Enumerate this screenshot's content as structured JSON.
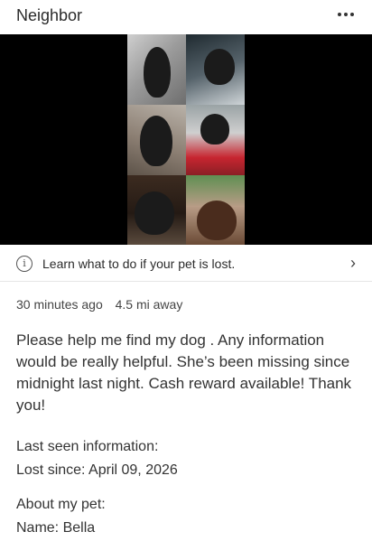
{
  "header": {
    "title": "Neighbor",
    "more_icon": "more-horizontal-icon"
  },
  "media": {
    "photo_count": 6
  },
  "lost_tip": {
    "icon": "info-icon",
    "text": "Learn what to do if your pet is lost.",
    "chevron_icon": "chevron-right-icon"
  },
  "post_meta": {
    "time_ago": "30 minutes ago",
    "distance": "4.5 mi away"
  },
  "post": {
    "body": "Please help me find my dog . Any information would be really helpful.  She’s been missing since midnight last night.  Cash reward available! Thank you!"
  },
  "last_seen": {
    "label": "Last seen information:",
    "value": "Lost since: April 09, 2026"
  },
  "about_pet": {
    "label": "About my pet:",
    "value": "Name: Bella"
  }
}
